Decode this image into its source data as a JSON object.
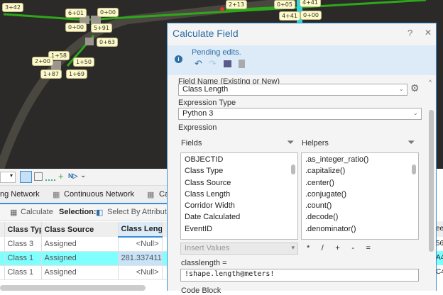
{
  "map": {
    "stations": [
      "3+42",
      "6+01",
      "0+00",
      "0+00",
      "5+91",
      "0+63",
      "1+58",
      "2+00",
      "1+50",
      "1+87",
      "1+69",
      "2+13",
      "0+05",
      "4+41",
      "4+41",
      "0+00"
    ]
  },
  "tabs": [
    "ng Network",
    "Continuous Network",
    "Ca"
  ],
  "table_toolbar": {
    "calculate": "Calculate",
    "selection": "Selection:",
    "select_by_attributes": "Select By Attributes"
  },
  "table": {
    "columns": [
      "Class Type",
      "Class Source",
      "Class Length"
    ],
    "rows": [
      [
        "Class 3",
        "Assigned",
        "<Null>"
      ],
      [
        "Class 1",
        "Assigned",
        "281.337411"
      ],
      [
        "Class 1",
        "Assigned",
        "<Null>"
      ]
    ],
    "right_fragments": [
      "ee",
      "56",
      "A4",
      "C4"
    ]
  },
  "dialog": {
    "title": "Calculate Field",
    "help": "?",
    "close": "✕",
    "pending": "Pending edits.",
    "field_name_label": "Field Name (Existing or New)",
    "field_name": "Class Length",
    "expr_type_label": "Expression Type",
    "expr_type": "Python 3",
    "expression_label": "Expression",
    "fields_label": "Fields",
    "helpers_label": "Helpers",
    "fields": [
      "OBJECTID",
      "Class Type",
      "Class Source",
      "Class Length",
      "Corridor Width",
      "Date Calculated",
      "EventID"
    ],
    "helpers": [
      ".as_integer_ratio()",
      ".capitalize()",
      ".center()",
      ".conjugate()",
      ".count()",
      ".decode()",
      ".denominator()"
    ],
    "insert_values": "Insert Values",
    "operators": [
      "*",
      "/",
      "+",
      "-",
      "="
    ],
    "expr_var": "classlength =",
    "expression": "!shape.length@meters!",
    "code_block": "Code Block"
  }
}
